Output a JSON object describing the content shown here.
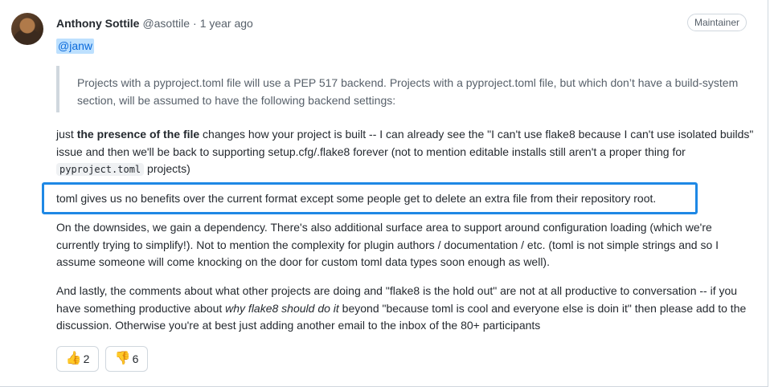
{
  "comment": {
    "author": "Anthony Sottile",
    "handle": "@asottile",
    "separator": "·",
    "time": "1 year ago",
    "role": "Maintainer",
    "mention": "@janw",
    "quote": "Projects with a pyproject.toml file will use a PEP 517 backend. Projects with a pyproject.toml file, but which don’t have a build-system section, will be assumed to have the following backend settings:",
    "p1": {
      "prefix": "just ",
      "bold": "the presence of the file",
      "middle": " changes how your project is built -- I can already see the \"I can't use flake8 because I can't use isolated builds\" issue and then we'll be back to supporting setup.cfg/.flake8 forever (not to mention editable installs still aren't a proper thing for ",
      "code": "pyproject.toml",
      "suffix": " projects)"
    },
    "p2": "toml gives us no benefits over the current format except some people get to delete an extra file from their repository root.",
    "p3": "On the downsides, we gain a dependency. There's also additional surface area to support around configuration loading (which we're currently trying to simplify!). Not to mention the complexity for plugin authors / documentation / etc. (toml is not simple strings and so I assume someone will come knocking on the door for custom toml data types soon enough as well).",
    "p4": {
      "prefix": "And lastly, the comments about what other projects are doing and \"flake8 is the hold out\" are not at all productive to conversation -- if you have something productive about ",
      "italic": "why flake8 should do it",
      "suffix": " beyond \"because toml is cool and everyone else is doin it\" then please add to the discussion. Otherwise you're at best just adding another email to the inbox of the 80+ participants"
    },
    "reactions": [
      {
        "icon": "thumbs-up-icon",
        "emoji": "👍",
        "count": "2"
      },
      {
        "icon": "thumbs-down-icon",
        "emoji": "👎",
        "count": "6"
      }
    ],
    "highlight_color": "#1e88e5"
  }
}
